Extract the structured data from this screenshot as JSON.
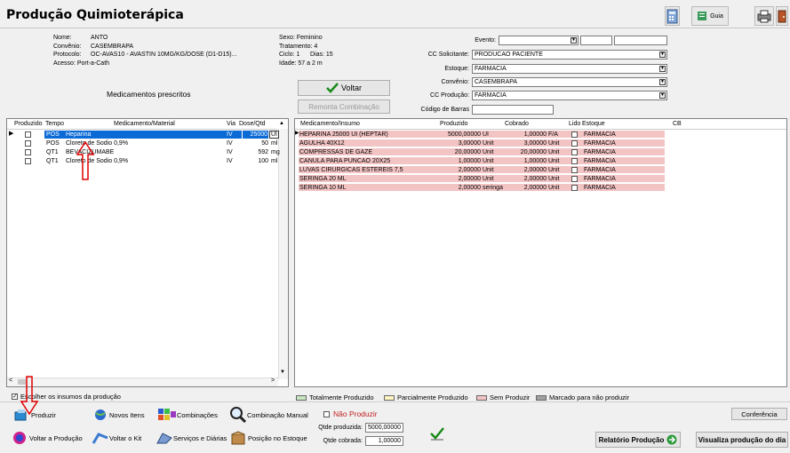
{
  "title": "Produção Quimioterápica",
  "toolbar": {
    "guia_label": "Guia"
  },
  "patient": {
    "nome_label": "Nome:",
    "nome": "ANTO",
    "convenio_label": "Convênio:",
    "convenio": "CASEMBRAPA",
    "protocolo_label": "Protocolo:",
    "protocolo": "OC-AVAS10 - AVASTIN 10MG/KG/DOSE (D1-D15)...",
    "acesso_label": "Acesso:",
    "acesso": "Port-a-Cath",
    "sexo": "Sexo: Feminino",
    "tratamento": "Tratamento: 4",
    "ciclo": "Ciclo: 1",
    "dias": "Dias: 15",
    "idade": "Idade: 57 a 2 m"
  },
  "form": {
    "evento_label": "Evento:",
    "cc_solicitante_label": "CC Solicitante:",
    "cc_solicitante": "PRODUCAO PACIENTE",
    "estoque_label": "Estoque:",
    "estoque": "FARMACIA",
    "convenio_label": "Convênio:",
    "convenio": "CASEMBRAPA",
    "cc_producao_label": "CC Produção:",
    "cc_producao": "FARMACIA",
    "codigo_barras_label": "Código de Barras"
  },
  "buttons": {
    "voltar": "Voltar",
    "remonta": "Remonta Combinação"
  },
  "left_section_title": "Medicamentos prescritos",
  "left_headers": [
    "Produzido",
    "Tempo",
    "Medicamento/Material",
    "Via",
    "Dose/Qtd"
  ],
  "left_rows": [
    {
      "tempo": "POS",
      "med": "Heparina",
      "via": "IV",
      "dose": "25000",
      "unit": "UI",
      "selected": true
    },
    {
      "tempo": "POS",
      "med": "Cloreto de Sodio 0,9%",
      "via": "IV",
      "dose": "50",
      "unit": "ml",
      "selected": false
    },
    {
      "tempo": "QT1",
      "med": "BEVACIZUMABE",
      "via": "IV",
      "dose": "592",
      "unit": "mg",
      "selected": false
    },
    {
      "tempo": "QT1",
      "med": "Cloreto de Sodio 0,9%",
      "via": "IV",
      "dose": "100",
      "unit": "ml",
      "selected": false
    }
  ],
  "right_headers": [
    "Medicamento/Insumo",
    "Produzido",
    "Cobrado",
    "Lido",
    "Estoque",
    "CB"
  ],
  "right_rows": [
    {
      "med": "HEPARINA 25000 UI (HEPTAR)",
      "prod": "5000,00000",
      "prod_unit": "UI",
      "cob": "1,00000",
      "cob_unit": "F/A",
      "estoque": "FARMACIA"
    },
    {
      "med": "AGULHA 40X12",
      "prod": "3,00000",
      "prod_unit": "Unit",
      "cob": "3,00000",
      "cob_unit": "Unit",
      "estoque": "FARMACIA"
    },
    {
      "med": "COMPRESSAS DE GAZE",
      "prod": "20,00000",
      "prod_unit": "Unit",
      "cob": "20,00000",
      "cob_unit": "Unit",
      "estoque": "FARMACIA"
    },
    {
      "med": "CANULA PARA PUNCAO 20X25",
      "prod": "1,00000",
      "prod_unit": "Unit",
      "cob": "1,00000",
      "cob_unit": "Unit",
      "estoque": "FARMACIA"
    },
    {
      "med": "LUVAS CIRURGICAS ESTEREIS 7,5",
      "prod": "2,00000",
      "prod_unit": "Unit",
      "cob": "2,00000",
      "cob_unit": "Unit",
      "estoque": "FARMACIA"
    },
    {
      "med": "SERINGA 20 ML",
      "prod": "2,00000",
      "prod_unit": "Unit",
      "cob": "2,00000",
      "cob_unit": "Unit",
      "estoque": "FARMACIA"
    },
    {
      "med": "SERINGA 10 ML",
      "prod": "2,00000",
      "prod_unit": "seringa",
      "cob": "2,00000",
      "cob_unit": "Unit",
      "estoque": "FARMACIA"
    }
  ],
  "escolher_label": "Escolher os insumos da produção",
  "legend": [
    {
      "label": "Totalmente Produzido",
      "color": "#c8e6c0"
    },
    {
      "label": "Parcialmente Produzido",
      "color": "#fff6c0"
    },
    {
      "label": "Sem Produzir",
      "color": "#f3c4c4"
    },
    {
      "label": "Marcado para não produzir",
      "color": "#a0a0a0"
    }
  ],
  "bottom": {
    "produzir": "Produzir",
    "novos_itens": "Novos Itens",
    "combinacoes": "Combinações",
    "combinacao_manual": "Combinação Manual",
    "nao_produzir": "Não Produzir",
    "conferencia": "Conferência",
    "voltar_producao": "Voltar a Produção",
    "voltar_kit": "Voltar o Kit",
    "servicos": "Serviços e Diárias",
    "posicao": "Posição no Estoque",
    "qtde_produzida_label": "Qtde produzida:",
    "qtde_produzida": "5000,00000",
    "qtde_cobrada_label": "Qtde cobrada:",
    "qtde_cobrada": "1,00000",
    "relatorio": "Relatório Produção",
    "visualiza": "Visualiza produção do dia"
  },
  "colors": {
    "pink": "#f3c4c4",
    "selected": "#0a6ad6",
    "annotation": "#e00000"
  }
}
